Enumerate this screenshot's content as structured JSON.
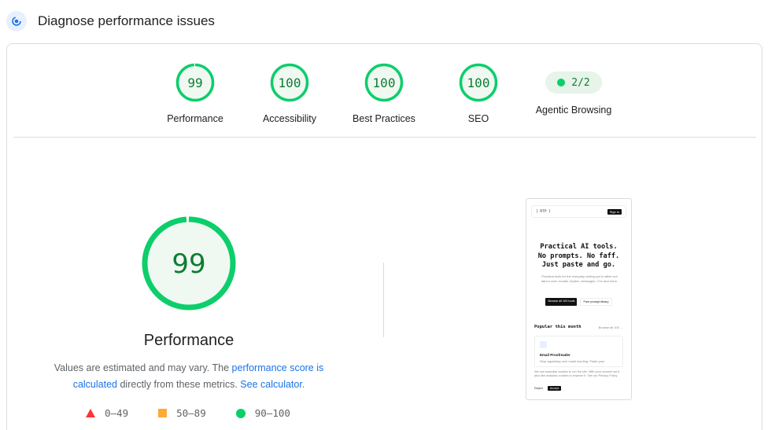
{
  "header": {
    "title": "Diagnose performance issues",
    "icon": "lighthouse-icon"
  },
  "colors": {
    "pass": "#0cce6b",
    "pass_text": "#0c7d31",
    "average": "#ffaa33",
    "fail": "#ff3333",
    "link": "#1a73e8"
  },
  "gauges": [
    {
      "label": "Performance",
      "score": "99",
      "value": 99
    },
    {
      "label": "Accessibility",
      "score": "100",
      "value": 100
    },
    {
      "label": "Best Practices",
      "score": "100",
      "value": 100
    },
    {
      "label": "SEO",
      "score": "100",
      "value": 100
    }
  ],
  "agentic": {
    "label": "Agentic Browsing",
    "value": "2/2"
  },
  "main": {
    "score": "99",
    "value": 99,
    "title": "Performance",
    "desc_1": "Values are estimated and may vary. The ",
    "desc_link_1": "performance score is calculated",
    "desc_2": " directly from these metrics. ",
    "desc_link_2": "See calculator."
  },
  "legend": [
    {
      "label": "0–49"
    },
    {
      "label": "50–89"
    },
    {
      "label": "90–100"
    }
  ],
  "screenshot": {
    "logo": "[ RTP ]",
    "signin": "Sign in",
    "headline_1": "Practical AI tools.",
    "headline_2": "No prompts. No faff.",
    "headline_3": "Just paste and go.",
    "subtext": "Practical tools for the everyday writing you'd rather not labour over: emails, replies, messages, CVs and more.",
    "btn_primary": "Browse all 100 tools",
    "btn_secondary": "Free prompt library",
    "popular_title": "Popular this month",
    "popular_link": "Browse all 100 →",
    "card_title": "Email Proofreader",
    "card_desc": "Stop agonising over email wording. Paste your",
    "cookie_text": "We use essential cookies to run the site. With your consent we'd also like analytics cookies to improve it. See our Privacy Policy.",
    "reject": "Reject",
    "accept": "Accept"
  }
}
